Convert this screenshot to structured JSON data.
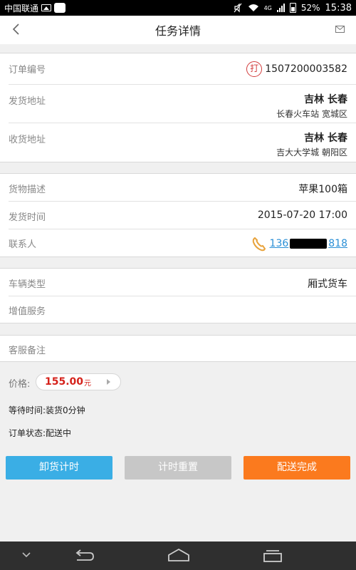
{
  "status_bar": {
    "carrier": "中国联通",
    "battery": "52%",
    "time": "15:38",
    "network": "4G"
  },
  "header": {
    "title": "任务详情",
    "back_icon": "back-chevron-icon",
    "mail_icon": "mail-icon"
  },
  "order": {
    "order_label": "订单编号",
    "print_stamp": "打",
    "order_number": "1507200003582",
    "ship_from_label": "发货地址",
    "ship_from_city": "吉林 长春",
    "ship_from_detail": "长春火车站  宽城区",
    "ship_to_label": "收货地址",
    "ship_to_city": "吉林 长春",
    "ship_to_detail": "吉大大学城  朝阳区"
  },
  "cargo": {
    "desc_label": "货物描述",
    "desc_value": "苹果100箱",
    "time_label": "发货时间",
    "time_value": "2015-07-20 17:00",
    "contact_label": "联系人",
    "phone_prefix": "136",
    "phone_suffix": "818"
  },
  "vehicle": {
    "type_label": "车辆类型",
    "type_value": "厢式货车",
    "service_label": "增值服务"
  },
  "remarks": {
    "label": "客服备注"
  },
  "summary": {
    "price_label": "价格:",
    "price_amount": "155.00",
    "price_unit": "元",
    "wait_label": "等待时间:",
    "wait_value": "装货0分钟",
    "status_label": "订单状态:",
    "status_value": "配送中"
  },
  "buttons": {
    "unload_timer": "卸货计时",
    "reset_timer": "计时重置",
    "delivery_complete": "配送完成"
  },
  "colors": {
    "blue": "#3aaee5",
    "gray": "#c7c7c7",
    "orange": "#fb7a1e",
    "price_red": "#d5221b"
  }
}
